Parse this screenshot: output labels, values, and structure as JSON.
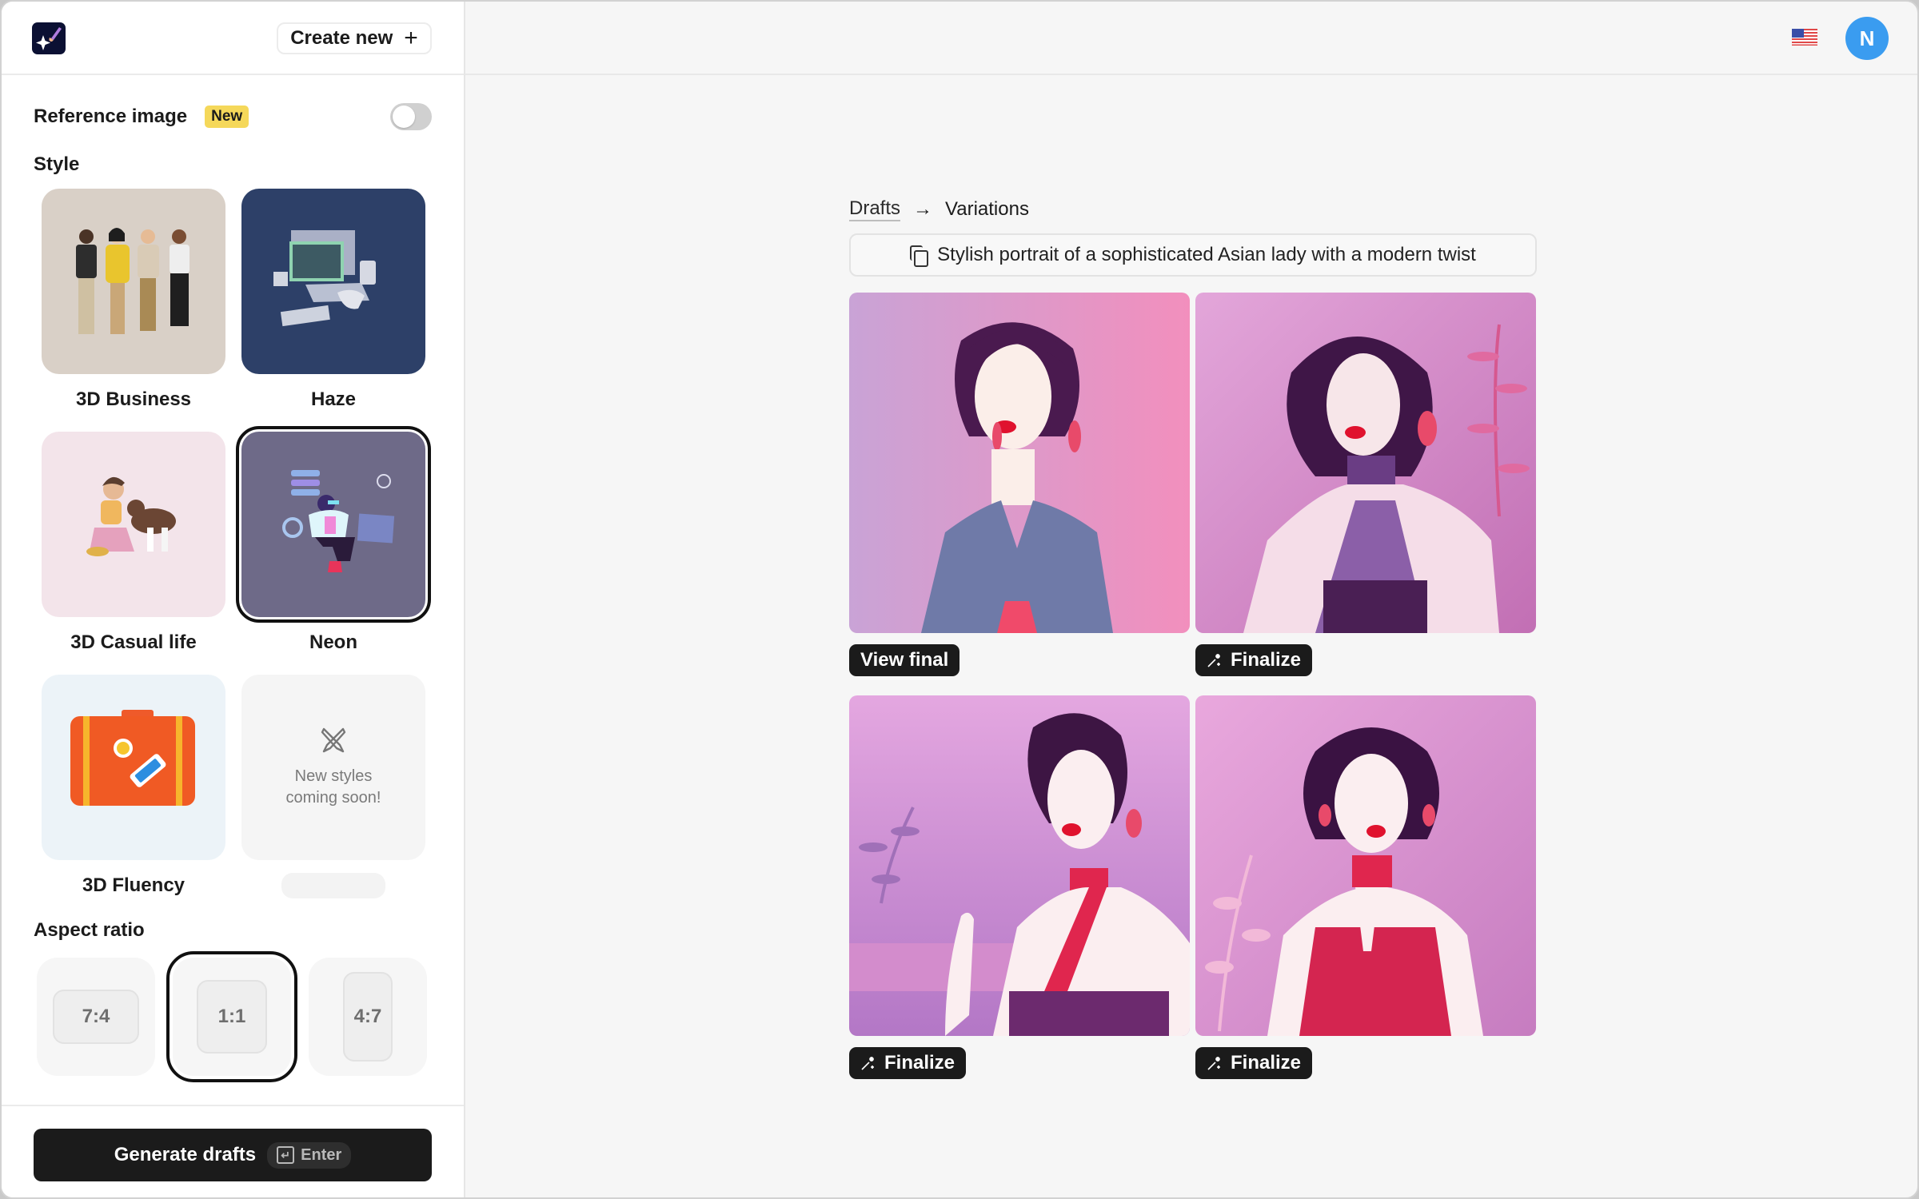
{
  "sidebar": {
    "logo_icon": "sparkle-brush-logo-icon",
    "create_new_label": "Create new",
    "create_new_icon": "plus-icon",
    "reference_image_label": "Reference image",
    "reference_image_badge": "New",
    "reference_image_enabled": false,
    "style_title": "Style",
    "styles": [
      {
        "name": "3D Business",
        "selected": false,
        "bg": "#d9d0c7"
      },
      {
        "name": "Haze",
        "selected": false,
        "bg": "#2d4068"
      },
      {
        "name": "3D Casual life",
        "selected": false,
        "bg": "#f3e4ea"
      },
      {
        "name": "Neon",
        "selected": true,
        "bg": "#6e6a88"
      },
      {
        "name": "3D Fluency",
        "selected": false,
        "bg": "#ecf3f8"
      }
    ],
    "coming_soon": {
      "icon": "pencil-brush-crossed-icon",
      "line1": "New styles",
      "line2": "coming soon!"
    },
    "aspect_title": "Aspect ratio",
    "aspect_ratios": [
      {
        "label": "7:4",
        "selected": false
      },
      {
        "label": "1:1",
        "selected": true
      },
      {
        "label": "4:7",
        "selected": false
      }
    ],
    "generate_label": "Generate drafts",
    "generate_shortcut": "Enter",
    "generate_shortcut_icon": "enter-key-icon"
  },
  "topbar": {
    "language_icon": "us-flag-icon",
    "avatar_initial": "N",
    "avatar_color": "#3a9cf0"
  },
  "main": {
    "breadcrumb": {
      "parent": "Drafts",
      "separator_icon": "arrow-right-icon",
      "current": "Variations"
    },
    "prompt_icon": "copy-icon",
    "prompt": "Stylish portrait of a sophisticated Asian lady with a modern twist",
    "variations": [
      {
        "action_label": "View final",
        "action_icon": null
      },
      {
        "action_label": "Finalize",
        "action_icon": "magic-wand-icon"
      },
      {
        "action_label": "Finalize",
        "action_icon": "magic-wand-icon"
      },
      {
        "action_label": "Finalize",
        "action_icon": "magic-wand-icon"
      }
    ]
  }
}
